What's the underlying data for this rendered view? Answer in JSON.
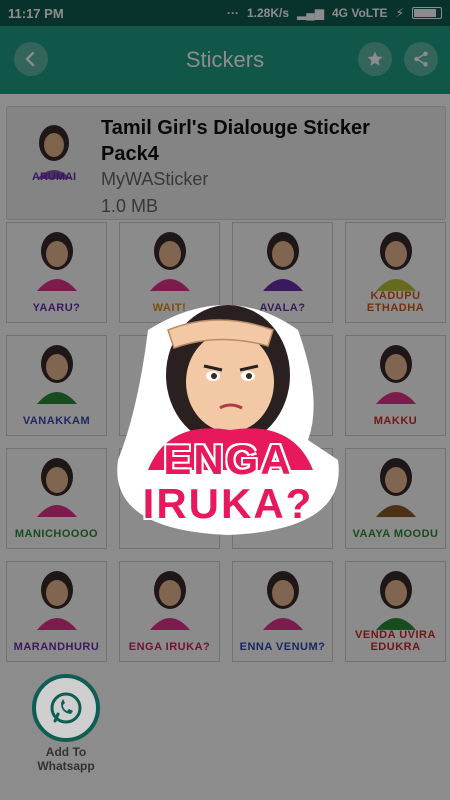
{
  "status_bar": {
    "time": "11:17 PM",
    "network_speed": "1.28K/s",
    "network_type": "4G VoLTE",
    "battery_level": 0.8
  },
  "app_bar": {
    "title": "Stickers",
    "back_icon": "back-arrow-icon",
    "favorite_icon": "star-icon",
    "share_icon": "share-icon"
  },
  "pack": {
    "title": "Tamil Girl's Dialouge Sticker Pack4",
    "author": "MyWASticker",
    "size": "1.0 MB",
    "tray_caption": "ARUMAI"
  },
  "stickers": [
    {
      "caption": "YAARU?",
      "color": "#6a2fb0",
      "shirt": "#e0338a"
    },
    {
      "caption": "WAIT!",
      "color": "#e58a1a",
      "shirt": "#e0338a"
    },
    {
      "caption": "AVALA?",
      "color": "#5d3aa0",
      "shirt": "#6a2fb0"
    },
    {
      "caption": "KADUPU ETHADHA",
      "color": "#d8541c",
      "shirt": "#b8c23a"
    },
    {
      "caption": "VANAKKAM",
      "color": "#3a4ab0",
      "shirt": "#2a8a3a"
    },
    {
      "caption": "",
      "color": "#333333",
      "shirt": "#e0338a"
    },
    {
      "caption": "",
      "color": "#333333",
      "shirt": "#e0338a"
    },
    {
      "caption": "MAKKU",
      "color": "#d02a2a",
      "shirt": "#e0338a"
    },
    {
      "caption": "MANICHOOOO",
      "color": "#2a8a3a",
      "shirt": "#e0338a"
    },
    {
      "caption": "",
      "color": "#333333",
      "shirt": "#e0338a"
    },
    {
      "caption": "",
      "color": "#333333",
      "shirt": "#e0338a"
    },
    {
      "caption": "VAAYA MOODU",
      "color": "#2a8a3a",
      "shirt": "#8a5a2a"
    },
    {
      "caption": "MARANDHURU",
      "color": "#6a2fb0",
      "shirt": "#e0338a"
    },
    {
      "caption": "ENGA IRUKA?",
      "color": "#d0206a",
      "shirt": "#e0338a"
    },
    {
      "caption": "ENNA VENUM?",
      "color": "#2a4ab0",
      "shirt": "#e0338a"
    },
    {
      "caption": "VENDA UVIRA EDUKRA",
      "color": "#d02a2a",
      "shirt": "#2a8a3a"
    }
  ],
  "preview": {
    "caption_line1": "ENGA",
    "caption_line2": "IRUKA?",
    "caption_color": "#e8185c"
  },
  "fab": {
    "label": "Add To Whatsapp",
    "icon": "whatsapp-icon"
  },
  "colors": {
    "primary": "#1f9e85",
    "primary_dark": "#0f5e52"
  }
}
